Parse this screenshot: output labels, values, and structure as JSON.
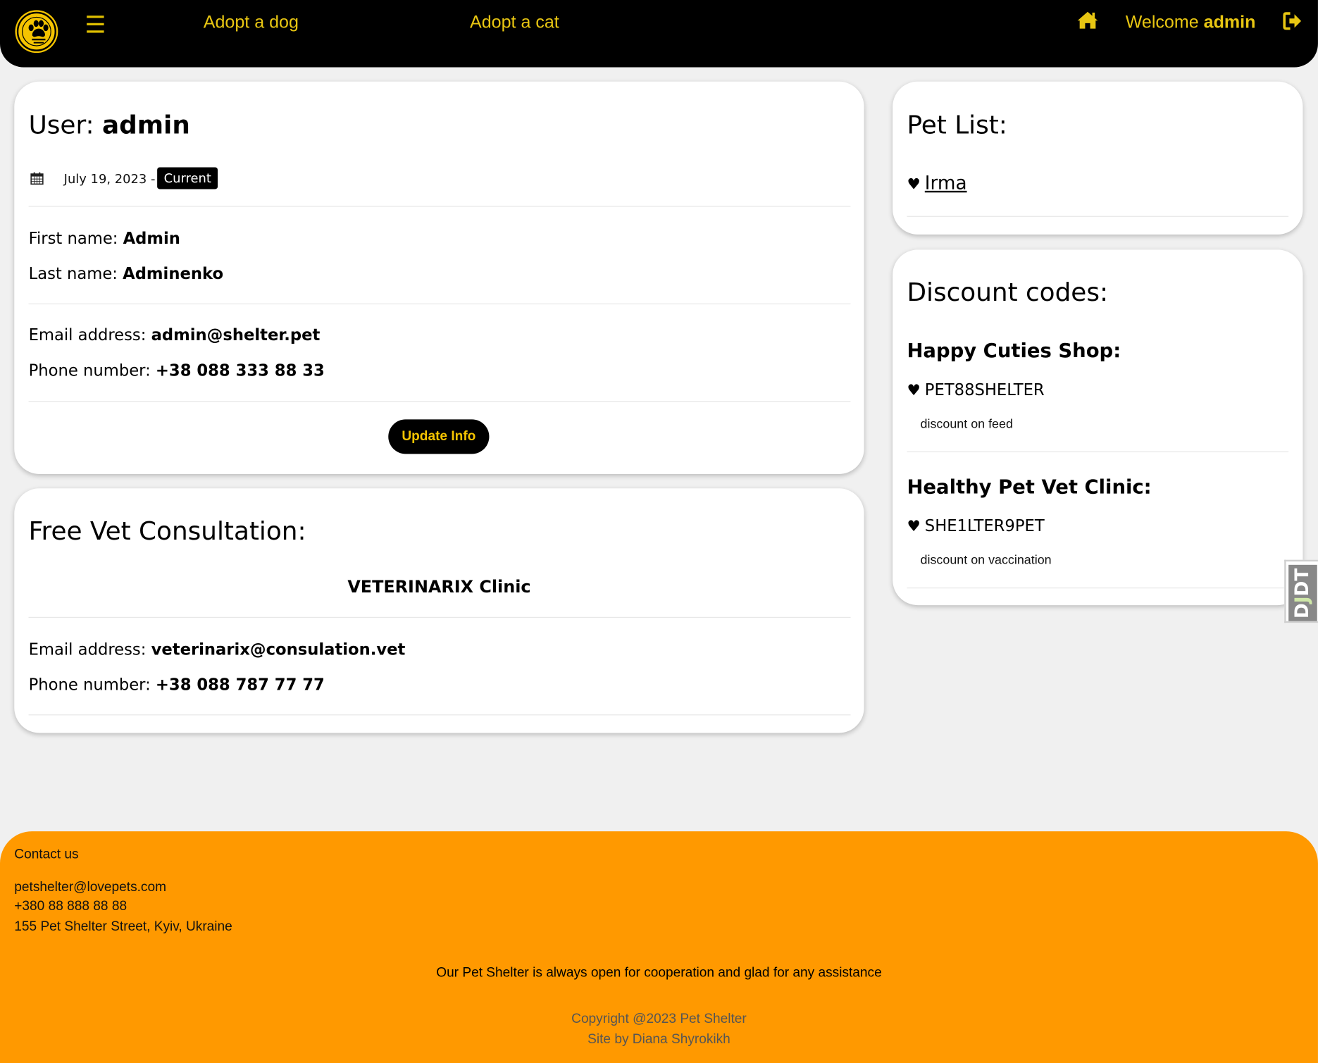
{
  "navbar": {
    "hamburger": "☰",
    "links": [
      "Adopt a dog",
      "Adopt a cat"
    ],
    "welcome_prefix": "Welcome ",
    "username": "admin",
    "accent_color": "#e8c612"
  },
  "user_card": {
    "title_prefix": "User: ",
    "username": "admin",
    "date": "July 19, 2023 -",
    "badge": "Current",
    "first_name_label": "First name: ",
    "first_name": "Admin",
    "last_name_label": "Last name: ",
    "last_name": "Adminenko",
    "email_label": "Email address: ",
    "email": "admin@shelter.pet",
    "phone_label": "Phone number: ",
    "phone": "+38 088 333 88 33",
    "update_button": "Update Info"
  },
  "vet_card": {
    "title": "Free Vet Consultation:",
    "clinic": "VETERINARIX Clinic",
    "email_label": "Email address: ",
    "email": "veterinarix@consulation.vet",
    "phone_label": "Phone number: ",
    "phone": "+38 088 787 77 77"
  },
  "pets_card": {
    "title": "Pet List:",
    "pets": [
      "Irma"
    ]
  },
  "discount_card": {
    "title": "Discount codes:",
    "codes": [
      {
        "shop": "Happy Cuties Shop:",
        "code": "PET88SHELTER",
        "description": "discount on feed"
      },
      {
        "shop": "Healthy Pet Vet Clinic:",
        "code": "SHE1LTER9PET",
        "description": "discount on vaccination"
      }
    ]
  },
  "debug_toolbar": {
    "label_d": "D",
    "label_j": "J",
    "label_dt": "DT"
  },
  "footer": {
    "contact_heading": "Contact us",
    "email": "petshelter@lovepets.com",
    "phone": "+380 88 888 88 88",
    "address": "155 Pet Shelter Street, Kyiv, Ukraine",
    "tagline": "Our Pet Shelter is always open for cooperation and glad for any assistance",
    "copyright": "Copyright @2023 Pet Shelter",
    "credit": "Site by Diana Shyrokikh",
    "background_color": "#ff9900"
  }
}
